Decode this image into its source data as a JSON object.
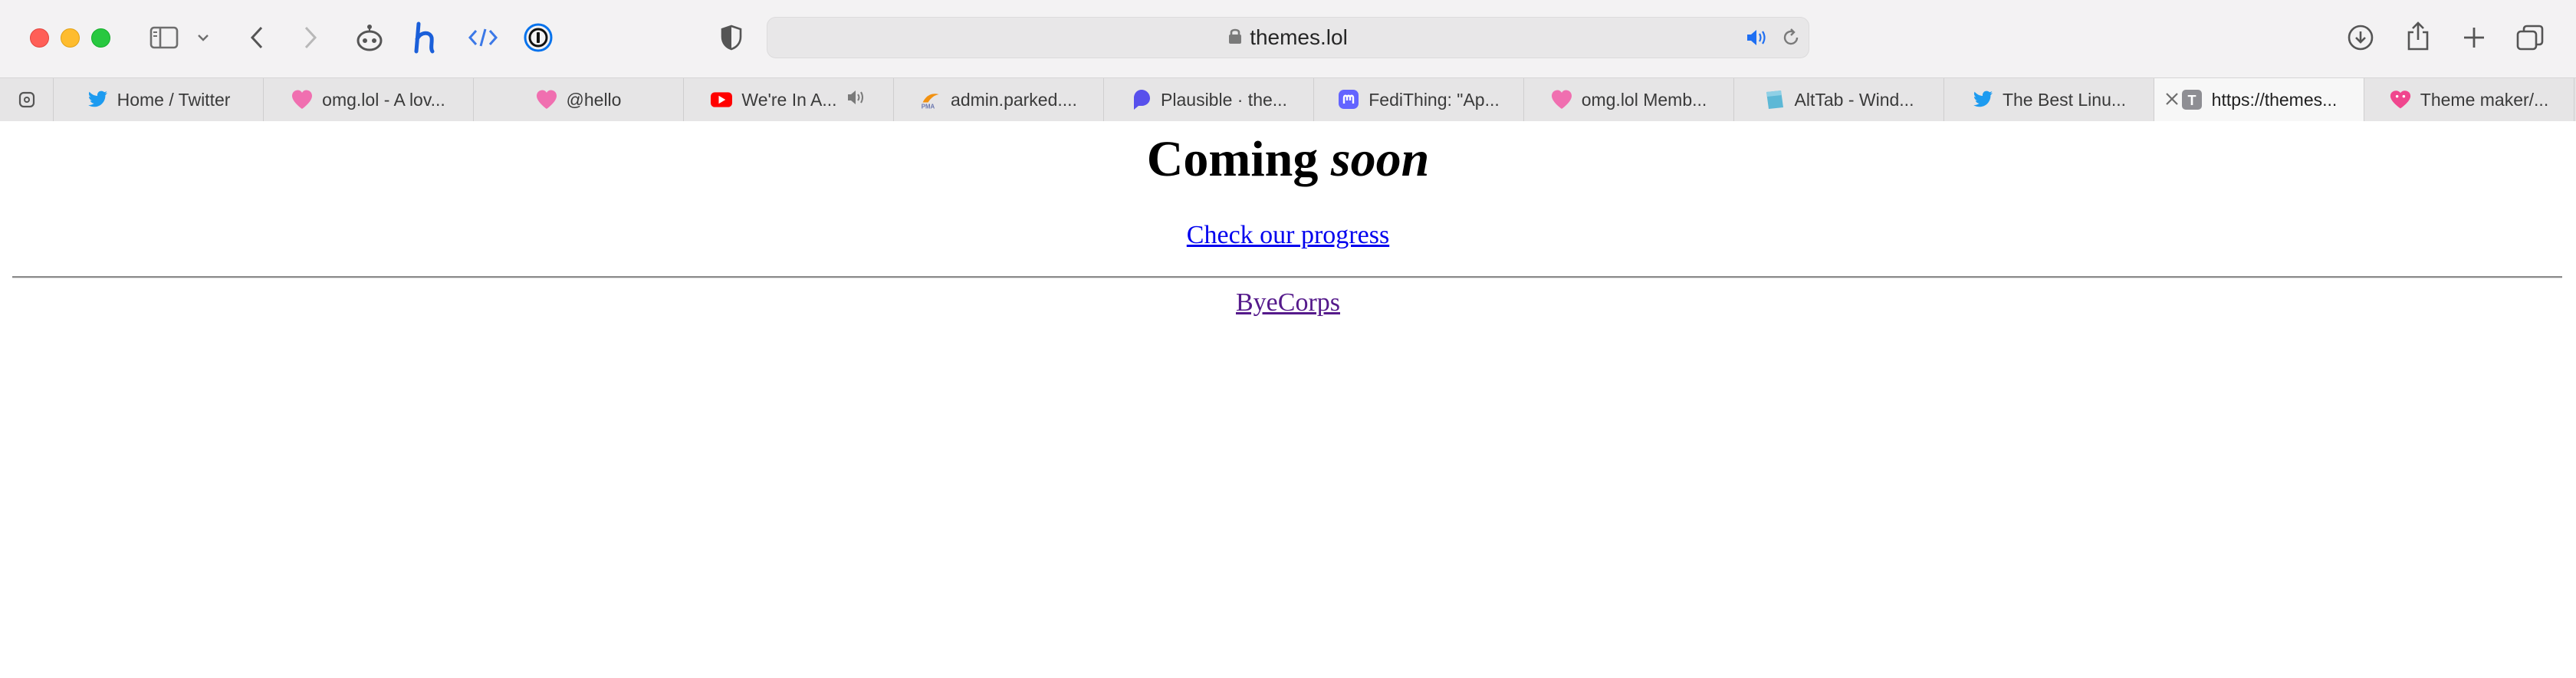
{
  "window": {
    "traffic_lights": [
      "close",
      "minimize",
      "zoom"
    ]
  },
  "toolbar": {
    "icons": [
      "sidebar-icon",
      "chevron-down-icon",
      "back-icon",
      "forward-icon",
      "robot-extension-icon",
      "h-extension-icon",
      "code-extension-icon",
      "password-manager-icon",
      "privacy-shield-icon",
      "download-icon",
      "share-icon",
      "plus-icon",
      "tab-overview-icon"
    ],
    "address": {
      "url_text": "themes.lol",
      "icons": [
        "lock-icon",
        "speaker-icon",
        "reload-icon"
      ]
    }
  },
  "tabs": [
    {
      "label": "Home / Twitter",
      "icon": "twitter-icon",
      "active": false
    },
    {
      "label": "omg.lol - A lov...",
      "icon": "heart-icon",
      "active": false
    },
    {
      "label": "@hello",
      "icon": "heart-icon",
      "active": false
    },
    {
      "label": "We're In A...",
      "icon": "youtube-icon",
      "active": false,
      "audio": true
    },
    {
      "label": "admin.parked....",
      "icon": "phpmyadmin-icon",
      "active": false
    },
    {
      "label": "Plausible · the...",
      "icon": "plausible-icon",
      "active": false
    },
    {
      "label": "FediThing: \"Ap...",
      "icon": "mastodon-icon",
      "active": false
    },
    {
      "label": "omg.lol Memb...",
      "icon": "heart-icon",
      "active": false
    },
    {
      "label": "AltTab - Wind...",
      "icon": "alttab-icon",
      "active": false
    },
    {
      "label": "The Best Linu...",
      "icon": "twitter-icon",
      "active": false
    },
    {
      "label": "https://themes...",
      "icon": "letter-t-icon",
      "active": true,
      "favicon_letter": "T"
    },
    {
      "label": "Theme maker/...",
      "icon": "omg-heart-icon",
      "active": false
    }
  ],
  "page": {
    "title_main": "Coming",
    "title_emphasis": "soon",
    "progress_link": "Check our progress",
    "footer_link": "ByeCorps"
  },
  "colors": {
    "link_unvisited": "#0000ee",
    "link_visited": "#551a8b",
    "twitter": "#1d9bf0",
    "heart": "#f06fb0",
    "youtube": "#ff0000",
    "mastodon": "#6364ff",
    "plausible": "#5850ec"
  }
}
